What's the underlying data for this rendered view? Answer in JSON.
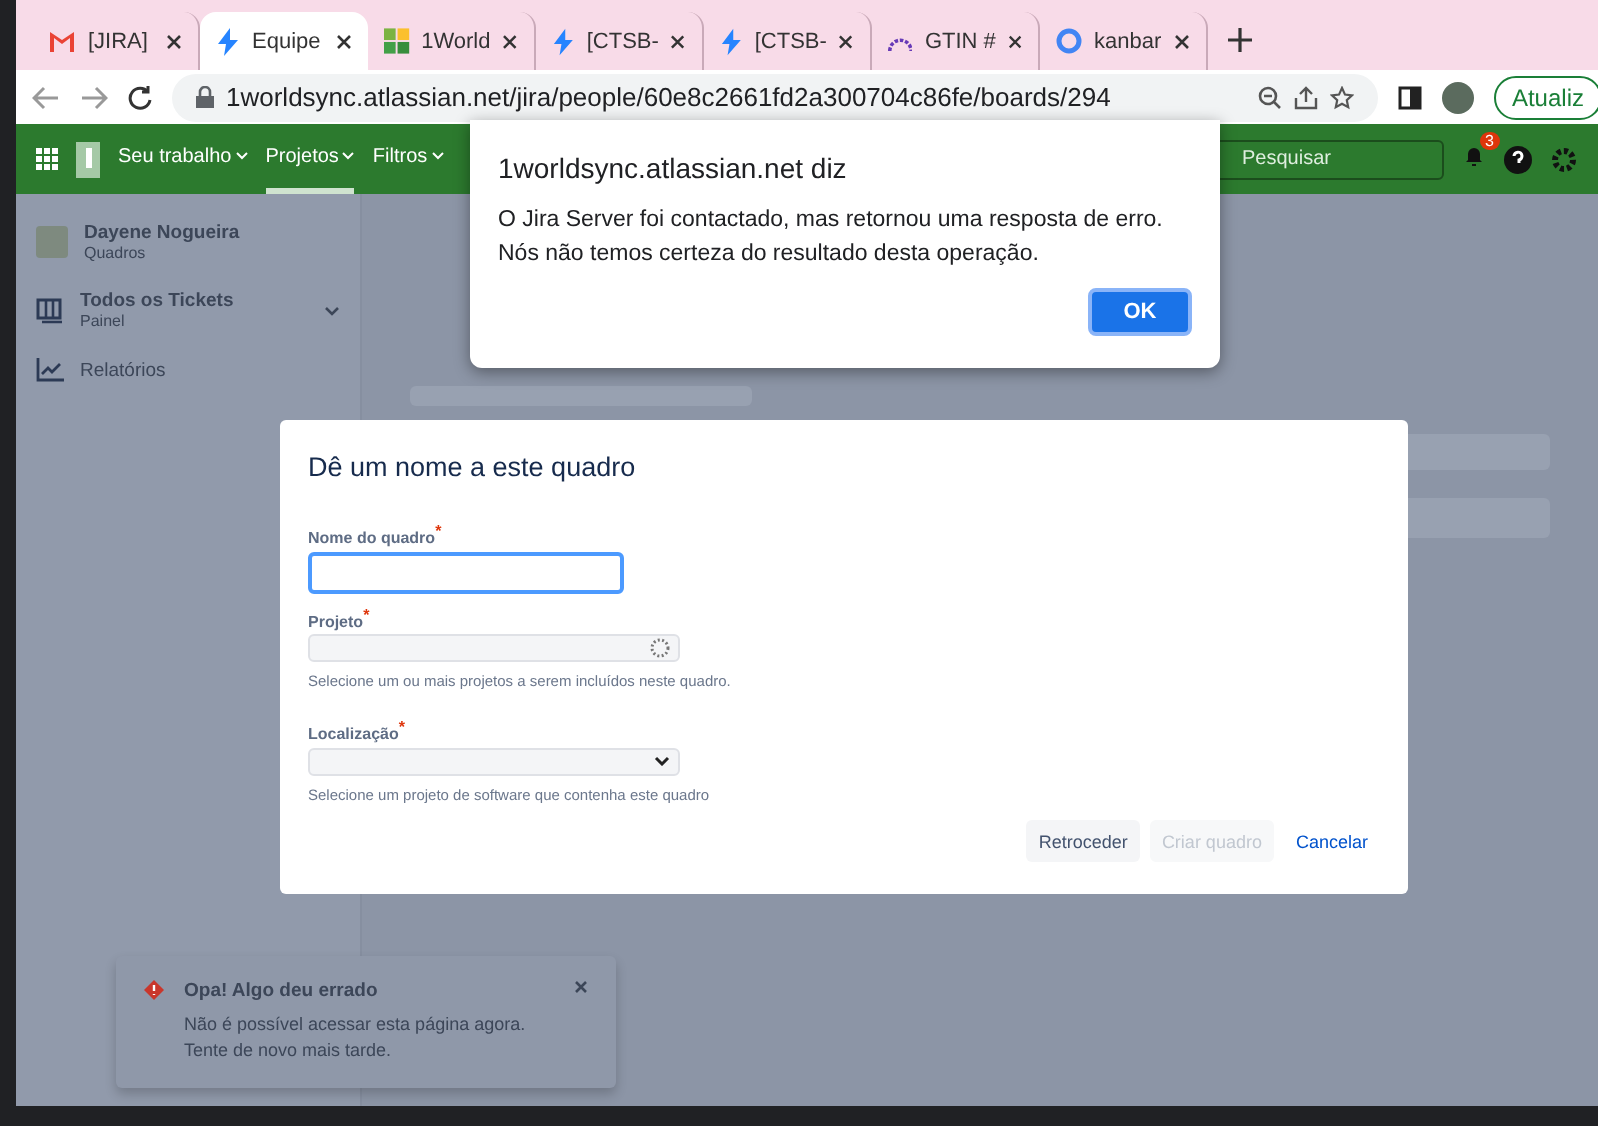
{
  "browser": {
    "tabs": [
      {
        "label": "[JIRA]",
        "kind": "gmail",
        "selected": false
      },
      {
        "label": "Equipe",
        "kind": "jira",
        "selected": true
      },
      {
        "label": "1World",
        "kind": "grid",
        "selected": false
      },
      {
        "label": "[CTSB-",
        "kind": "jira",
        "selected": false
      },
      {
        "label": "[CTSB-",
        "kind": "jira",
        "selected": false
      },
      {
        "label": "GTIN #",
        "kind": "arc",
        "selected": false
      },
      {
        "label": "kanbar",
        "kind": "google",
        "selected": false
      }
    ],
    "url": "1worldsync.atlassian.net/jira/people/60e8c2661fd2a300704c86fe/boards/294",
    "update_button": "Atualiz"
  },
  "nav": {
    "items": [
      {
        "label": "Seu trabalho",
        "selected": false
      },
      {
        "label": "Projetos",
        "selected": true
      },
      {
        "label": "Filtros",
        "selected": false
      }
    ],
    "search_placeholder": "Pesquisar",
    "notification_count": "3"
  },
  "sidebar": {
    "items": [
      {
        "kind": "avatar",
        "label": "Dayene Nogueira",
        "subtitle": "Quadros"
      },
      {
        "kind": "board",
        "label": "Todos os Tickets",
        "subtitle": "Painel"
      },
      {
        "kind": "reports",
        "label": "Relatórios"
      }
    ]
  },
  "alert": {
    "title": "1worldsync.atlassian.net diz",
    "message": "O Jira Server foi contactado, mas retornou uma resposta de erro. Nós não temos certeza do resultado desta operação.",
    "button": "OK"
  },
  "modal": {
    "title": "Dê um nome a este quadro",
    "fields": [
      {
        "kind": "text",
        "label": "Nome do quadro$^{*}$",
        "focused": true
      },
      {
        "kind": "loading",
        "label": "Projeto$^{*}$",
        "help": "Selecione um ou mais projetos a serem incluídos neste quadro."
      },
      {
        "kind": "select",
        "label": "Localização$^{*}$",
        "help": "Selecione um projeto de software que contenha este quadro"
      }
    ],
    "buttons": [
      {
        "kind": "secondary",
        "label": "Retroceder",
        "disabled": false
      },
      {
        "kind": "primary",
        "label": "Criar quadro",
        "disabled": true
      },
      {
        "kind": "link",
        "label": "Cancelar",
        "disabled": false
      }
    ]
  },
  "toast": {
    "title": "Opa! Algo deu errado",
    "message": "Não é possível acessar esta página agora. Tente de novo mais tarde."
  }
}
